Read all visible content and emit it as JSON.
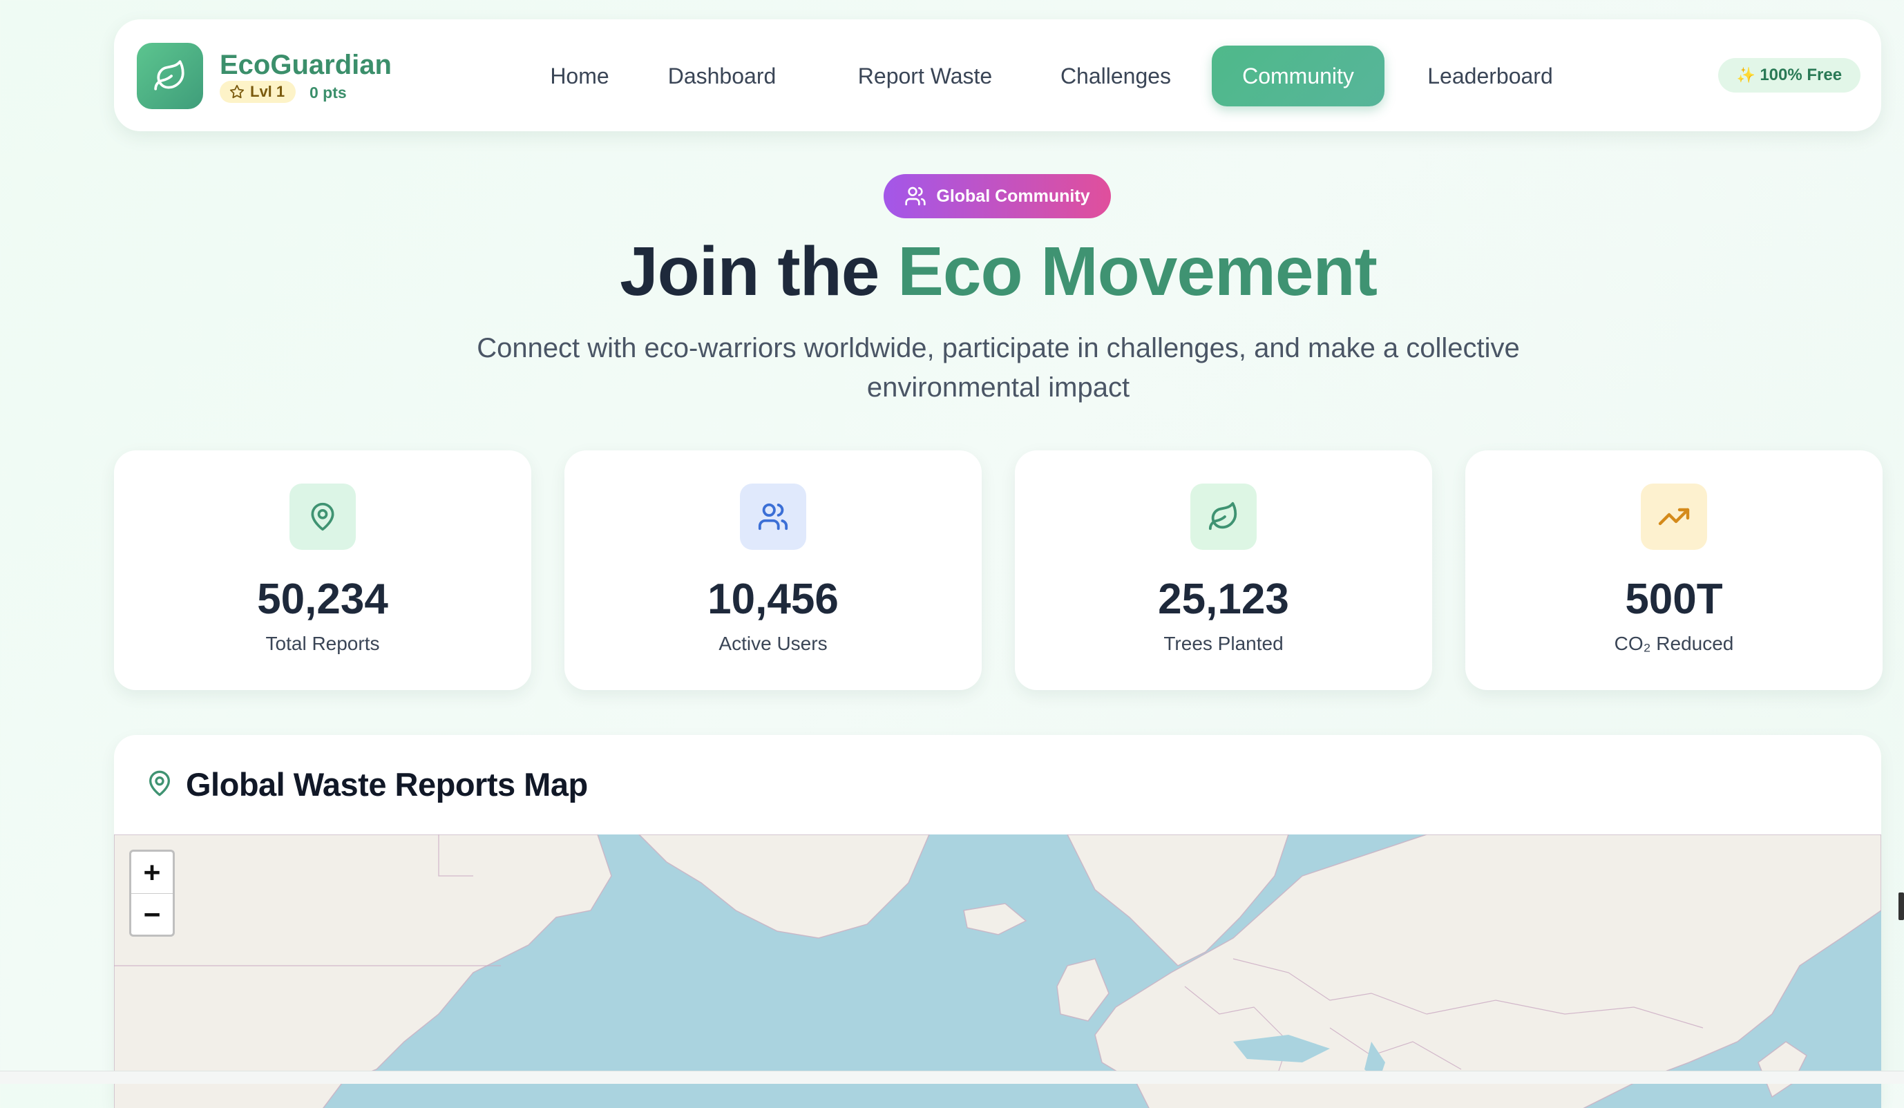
{
  "brand": {
    "name": "EcoGuardian",
    "level": "Lvl 1",
    "points": "0 pts"
  },
  "nav": {
    "items": [
      {
        "label": "Home",
        "active": false
      },
      {
        "label": "Dashboard",
        "active": false
      },
      {
        "label": "Report Waste",
        "active": false
      },
      {
        "label": "Challenges",
        "active": false
      },
      {
        "label": "Community",
        "active": true
      },
      {
        "label": "Leaderboard",
        "active": false
      }
    ],
    "free_badge": "100% Free"
  },
  "hero": {
    "pill": "Global Community",
    "title_part1": "Join the ",
    "title_accent": "Eco Movement",
    "subtitle": "Connect with eco-warriors worldwide, participate in challenges, and make a collective environmental impact"
  },
  "stats": [
    {
      "value": "50,234",
      "label": "Total Reports",
      "icon": "map-pin-icon",
      "icon_bg": "#dcf5e6",
      "icon_color": "#3f9372"
    },
    {
      "value": "10,456",
      "label": "Active Users",
      "icon": "users-icon",
      "icon_bg": "#e0e9fc",
      "icon_color": "#3b6fd6"
    },
    {
      "value": "25,123",
      "label": "Trees Planted",
      "icon": "leaf-icon",
      "icon_bg": "#ddf6e4",
      "icon_color": "#3f9372"
    },
    {
      "value": "500T",
      "label": "CO₂ Reduced",
      "icon": "trending-up-icon",
      "icon_bg": "#fdf1cf",
      "icon_color": "#d48a1a"
    }
  ],
  "map": {
    "title": "Global Waste Reports Map",
    "zoom_in": "+",
    "zoom_out": "−"
  },
  "colors": {
    "brand_green": "#3f9372",
    "accent_purple": "#a357e9",
    "accent_pink": "#e04f9c",
    "map_water": "#aad3df",
    "map_land": "#f2efe9"
  }
}
